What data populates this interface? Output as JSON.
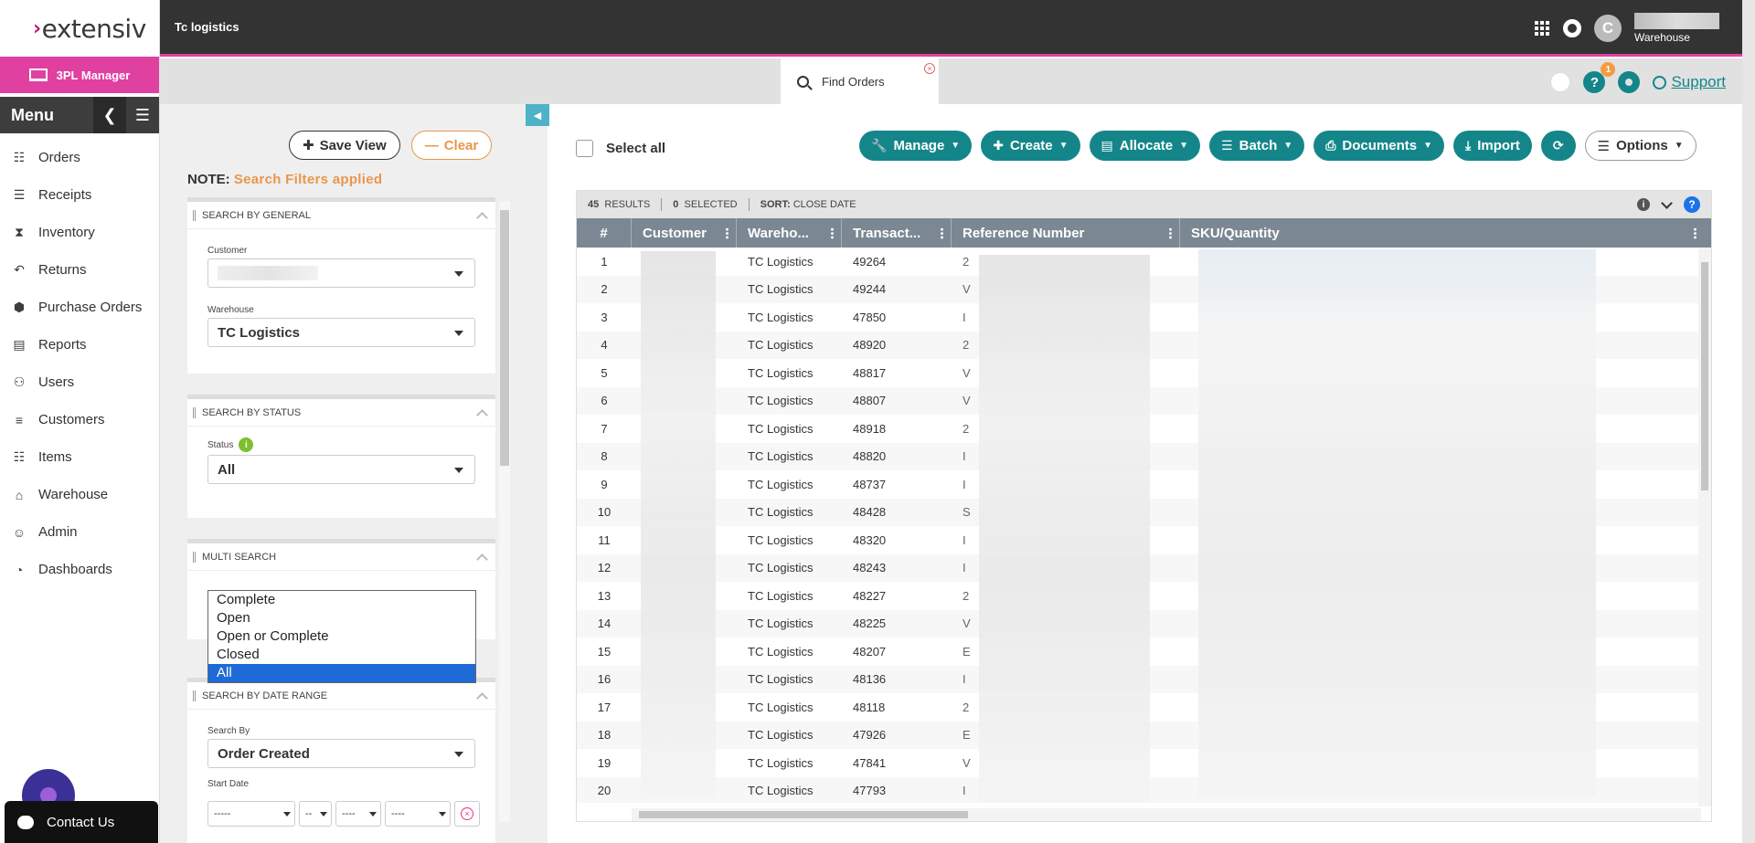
{
  "brand": {
    "logo_text": "extensiv",
    "logo_mark": "›",
    "product": "3PL Manager"
  },
  "topbar": {
    "app_title": "Tc logistics",
    "avatar_letter": "C",
    "user_role": "Warehouse"
  },
  "menu": {
    "title": "Menu",
    "items": [
      {
        "label": "Orders",
        "icon": "sitemap-icon"
      },
      {
        "label": "Receipts",
        "icon": "receipt-icon"
      },
      {
        "label": "Inventory",
        "icon": "hourglass-icon"
      },
      {
        "label": "Returns",
        "icon": "reply-icon"
      },
      {
        "label": "Purchase Orders",
        "icon": "hexagon-icon"
      },
      {
        "label": "Reports",
        "icon": "report-icon"
      },
      {
        "label": "Users",
        "icon": "users-icon"
      },
      {
        "label": "Customers",
        "icon": "handshake-icon"
      },
      {
        "label": "Items",
        "icon": "grid-list-icon"
      },
      {
        "label": "Warehouse",
        "icon": "home-icon"
      },
      {
        "label": "Admin",
        "icon": "user-icon"
      },
      {
        "label": "Dashboards",
        "icon": "gauge-icon"
      }
    ]
  },
  "contact": {
    "label": "Contact Us"
  },
  "tabs": {
    "find_orders": "Find Orders",
    "support": "Support",
    "notification_count": "1"
  },
  "filters": {
    "save_view": "Save View",
    "clear": "Clear",
    "note_label": "NOTE:",
    "note_text": "Search Filters applied",
    "general": {
      "title": "SEARCH BY GENERAL",
      "customer_label": "Customer",
      "warehouse_label": "Warehouse",
      "warehouse_value": "TC Logistics"
    },
    "status": {
      "title": "SEARCH BY STATUS",
      "status_label": "Status",
      "status_value": "All"
    },
    "multi": {
      "title": "MULTI SEARCH"
    },
    "status_options": [
      "Complete",
      "Open",
      "Open or Complete",
      "Closed",
      "All"
    ],
    "status_selected_index": 4,
    "date": {
      "title": "SEARCH BY DATE RANGE",
      "search_by_label": "Search By",
      "search_by_value": "Order Created",
      "start_date_label": "Start Date",
      "month": "-----",
      "day": "--",
      "year": "----",
      "time": "----"
    }
  },
  "toolbar": {
    "select_all": "Select all",
    "manage": "Manage",
    "create": "Create",
    "allocate": "Allocate",
    "batch": "Batch",
    "documents": "Documents",
    "import": "Import",
    "options": "Options"
  },
  "grid": {
    "results_count": "45",
    "results_label": "RESULTS",
    "selected_count": "0",
    "selected_label": "SELECTED",
    "sort_label": "SORT:",
    "sort_value": "CLOSE DATE",
    "columns": [
      "#",
      "Customer",
      "Wareho...",
      "Transact...",
      "Reference Number",
      "SKU/Quantity"
    ],
    "rows": [
      {
        "n": "1",
        "warehouse": "TC Logistics",
        "transaction": "49264",
        "ref": "2"
      },
      {
        "n": "2",
        "warehouse": "TC Logistics",
        "transaction": "49244",
        "ref": "V"
      },
      {
        "n": "3",
        "warehouse": "TC Logistics",
        "transaction": "47850",
        "ref": "I"
      },
      {
        "n": "4",
        "warehouse": "TC Logistics",
        "transaction": "48920",
        "ref": "2"
      },
      {
        "n": "5",
        "warehouse": "TC Logistics",
        "transaction": "48817",
        "ref": "V"
      },
      {
        "n": "6",
        "warehouse": "TC Logistics",
        "transaction": "48807",
        "ref": "V"
      },
      {
        "n": "7",
        "warehouse": "TC Logistics",
        "transaction": "48918",
        "ref": "2"
      },
      {
        "n": "8",
        "warehouse": "TC Logistics",
        "transaction": "48820",
        "ref": "I"
      },
      {
        "n": "9",
        "warehouse": "TC Logistics",
        "transaction": "48737",
        "ref": "I"
      },
      {
        "n": "10",
        "warehouse": "TC Logistics",
        "transaction": "48428",
        "ref": "S"
      },
      {
        "n": "11",
        "warehouse": "TC Logistics",
        "transaction": "48320",
        "ref": "I"
      },
      {
        "n": "12",
        "warehouse": "TC Logistics",
        "transaction": "48243",
        "ref": "I"
      },
      {
        "n": "13",
        "warehouse": "TC Logistics",
        "transaction": "48227",
        "ref": "2"
      },
      {
        "n": "14",
        "warehouse": "TC Logistics",
        "transaction": "48225",
        "ref": "V"
      },
      {
        "n": "15",
        "warehouse": "TC Logistics",
        "transaction": "48207",
        "ref": "E"
      },
      {
        "n": "16",
        "warehouse": "TC Logistics",
        "transaction": "48136",
        "ref": "I"
      },
      {
        "n": "17",
        "warehouse": "TC Logistics",
        "transaction": "48118",
        "ref": "2"
      },
      {
        "n": "18",
        "warehouse": "TC Logistics",
        "transaction": "47926",
        "ref": "E"
      },
      {
        "n": "19",
        "warehouse": "TC Logistics",
        "transaction": "47841",
        "ref": "V"
      },
      {
        "n": "20",
        "warehouse": "TC Logistics",
        "transaction": "47793",
        "ref": "I"
      }
    ]
  },
  "colors": {
    "teal": "#14868a",
    "pink": "#e040a0",
    "orange": "#e9964b",
    "header_gray": "#7b8893"
  }
}
